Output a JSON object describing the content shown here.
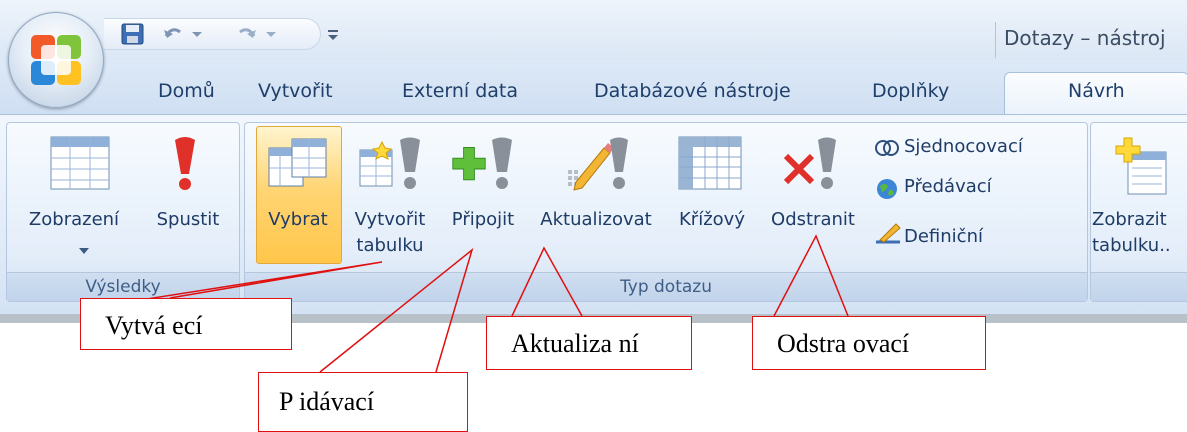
{
  "window": {
    "title": "Dotazy – nástroj"
  },
  "tabs": [
    "Domů",
    "Vytvořit",
    "Externí data",
    "Databázové nástroje",
    "Doplňky",
    "Návrh"
  ],
  "active_tab": "Návrh",
  "groups": {
    "vysledky": {
      "label": "Výsledky",
      "buttons": {
        "zobrazeni": "Zobrazení",
        "spustit": "Spustit"
      }
    },
    "typ_dotazu": {
      "label": "Typ dotazu",
      "buttons": {
        "vybrat": "Vybrat",
        "vytvorit_1": "Vytvořit",
        "vytvorit_2": "tabulku",
        "pripojit": "Připojit",
        "aktualizovat": "Aktualizovat",
        "krizovy": "Křížový",
        "odstranit": "Odstranit"
      },
      "small_buttons": {
        "sjednocovaci": "Sjednocovací",
        "predavaci": "Předávací",
        "definicni": "Definiční"
      }
    },
    "zobrazit": {
      "buttons": {
        "zobrazit_1": "Zobrazit",
        "zobrazit_2": "tabulku.."
      }
    }
  },
  "callouts": {
    "vytvarejici": "Vytvá ecí",
    "aktualizacni": "Aktualiza ní",
    "odstranovaci": "Odstra ovací",
    "pridavaci": "P idávací"
  },
  "colors": {
    "callout_border": "#e01010",
    "selected_bg": "#ffc64a",
    "tab_text": "#1f3f6a"
  },
  "icons": {
    "office_button": "office-logo-icon",
    "qat": [
      "save-icon",
      "undo-icon",
      "redo-icon",
      "customize-qat-icon"
    ]
  }
}
